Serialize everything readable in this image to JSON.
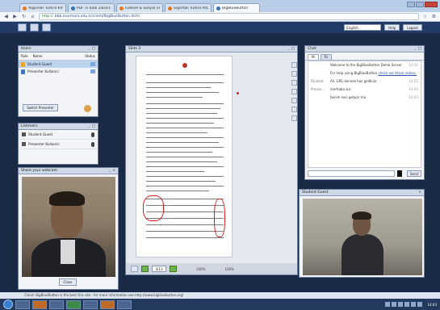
{
  "browser": {
    "tabs": [
      {
        "label": "Yogunlar Turkce Kitab...",
        "active": false
      },
      {
        "label": "PDF in bildi ulasilir...",
        "active": false
      },
      {
        "label": "Fiziksel & Sosyal cev...",
        "active": false
      },
      {
        "label": "Sigortali Turkce Kitab...",
        "active": false
      },
      {
        "label": "BigBlueButton",
        "active": true
      }
    ],
    "url_secure": "http://",
    "url": "bbb.marmara.edu.tr/client/BigBlueButton.html"
  },
  "toolbar": {
    "language": "English",
    "help_label": "Help",
    "logout_label": "Logout"
  },
  "users_panel": {
    "title": "Users",
    "columns": [
      "Role",
      "Name",
      "Status"
    ],
    "rows": [
      {
        "name": "Student Guest",
        "selected": true
      },
      {
        "name": "Presenter Kullanici",
        "selected": false
      }
    ],
    "switch_button": "Switch Presenter"
  },
  "listeners_panel": {
    "title": "Listeners",
    "rows": [
      {
        "name": "Student Guest"
      },
      {
        "name": "Presenter Kullanici"
      }
    ]
  },
  "webcam_panel": {
    "title": "Share your webcam",
    "close_label": "Close"
  },
  "presentation": {
    "title": "Slide 3",
    "page": "3/13",
    "zoom_a": "100%",
    "zoom_b": "100%"
  },
  "chat": {
    "title": "Chat",
    "tabs": [
      "All",
      "Ri"
    ],
    "messages": [
      {
        "who": "",
        "text": "Welcome to the BigBlueButton Demo Server.",
        "time": "14:02"
      },
      {
        "who": "",
        "text": "For help using BigBlueButton",
        "link": "check out these videos.",
        "time": ""
      },
      {
        "who": "Student",
        "text": "Ali, GRE dersine hos geldiniz.",
        "time": "14:02"
      },
      {
        "who": "Presen...",
        "text": "merhaba sizi",
        "time": "14:03"
      },
      {
        "who": "",
        "text": "benim sesi geliyor mu",
        "time": "14:03"
      }
    ],
    "send_label": "Send"
  },
  "webcam2": {
    "title": "Student Guest"
  },
  "statusbar": {
    "text": "Client: BigBlueButton is the best this site - for more information see http://www.bigbluebutton.org/"
  },
  "taskbar": {
    "clock": "14:03"
  },
  "colors": {
    "app_bg": "#1a2a44",
    "toolbar_bg": "#213a66",
    "panel_bg": "#f2f4f8",
    "accent_red": "#d02020"
  }
}
